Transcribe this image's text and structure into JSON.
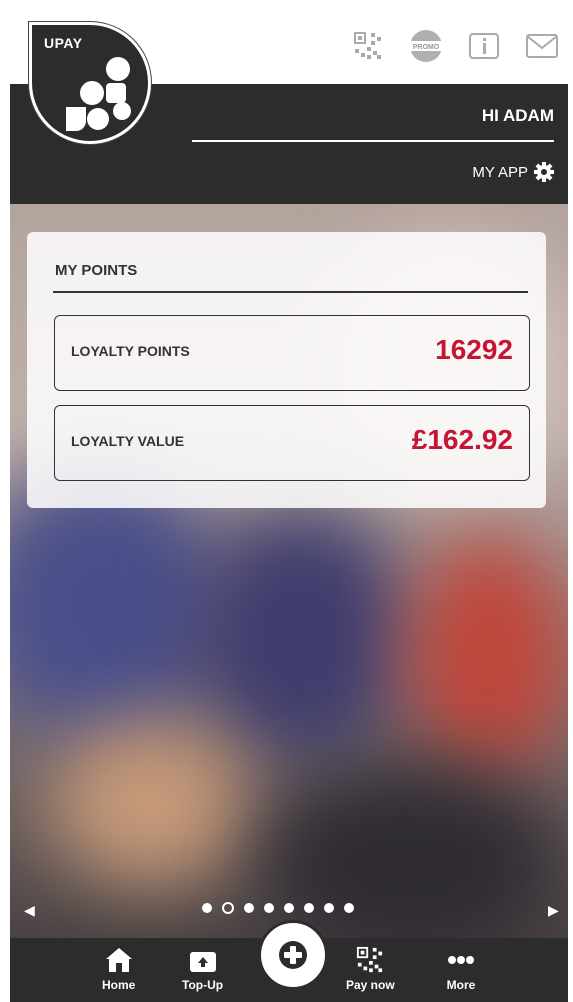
{
  "header": {
    "logo_text": "UPAY",
    "greeting": "HI ADAM",
    "my_app_label": "MY APP",
    "icons": [
      "qr-code-icon",
      "promo-icon",
      "info-icon",
      "mail-icon"
    ],
    "promo_text": "PROMO"
  },
  "points": {
    "title": "MY POINTS",
    "rows": [
      {
        "label": "LOYALTY POINTS",
        "value": "16292"
      },
      {
        "label": "LOYALTY VALUE",
        "value": "£162.92"
      }
    ]
  },
  "carousel": {
    "pages": 8,
    "active_index": 1
  },
  "nav": {
    "items": [
      {
        "label": "Home",
        "icon": "home-icon"
      },
      {
        "label": "Top-Up",
        "icon": "top-up-icon"
      },
      {
        "label": "",
        "icon": "plus-icon"
      },
      {
        "label": "Pay now",
        "icon": "qr-code-icon"
      },
      {
        "label": "More",
        "icon": "more-icon"
      }
    ]
  },
  "colors": {
    "dark": "#2c2c2c",
    "accent_red": "#c41532",
    "white": "#ffffff"
  }
}
